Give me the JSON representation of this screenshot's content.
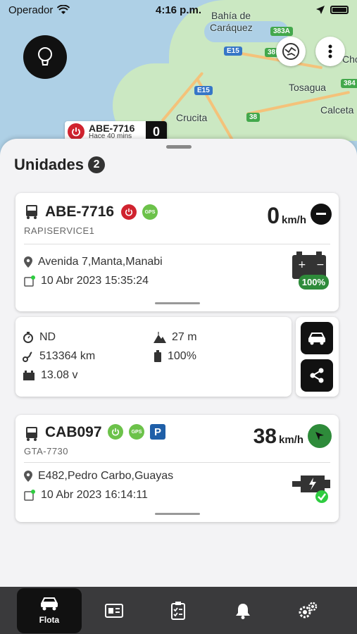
{
  "status_bar": {
    "carrier": "Operador",
    "time": "4:16 p.m."
  },
  "map": {
    "cities": [
      "Bahía de",
      "Caráquez",
      "Tosagua",
      "Calceta",
      "Crucita",
      "Cho"
    ],
    "shields": [
      "383A",
      "E15",
      "38",
      "E15",
      "384",
      "38"
    ],
    "marker": {
      "plate": "ABE-7716",
      "subtitle": "Hace 40 mins",
      "count": "0"
    }
  },
  "sheet": {
    "title": "Unidades",
    "count": "2",
    "units": [
      {
        "plate": "ABE-7716",
        "company": "RAPISERVICE1",
        "speed": "0",
        "speed_unit": "km/h",
        "address": "Avenida 7,Manta,Manabi",
        "datetime": "10 Abr 2023 15:35:24",
        "battery": "100%",
        "gps_label": "GPS"
      },
      {
        "plate": "CAB097",
        "company": "GTA-7730",
        "speed": "38",
        "speed_unit": "km/h",
        "address": "E482,Pedro Carbo,Guayas",
        "datetime": "10 Abr 2023 16:14:11",
        "gps_label": "GPS",
        "parking_label": "P"
      }
    ],
    "details": {
      "odometer_label": "ND",
      "altitude": "27 m",
      "mileage": "513364 km",
      "battery_pct": "100%",
      "voltage": "13.08 v"
    }
  },
  "tabbar": {
    "tabs": [
      {
        "label": "Flota",
        "active": true
      },
      {
        "label": "",
        "active": false
      },
      {
        "label": "",
        "active": false
      },
      {
        "label": "",
        "active": false
      },
      {
        "label": "",
        "active": false
      }
    ]
  },
  "colors": {
    "accent_green": "#2e8b3a",
    "power_red": "#d0232f",
    "gps_green": "#6cc24a",
    "parking_blue": "#1f5fa8"
  }
}
